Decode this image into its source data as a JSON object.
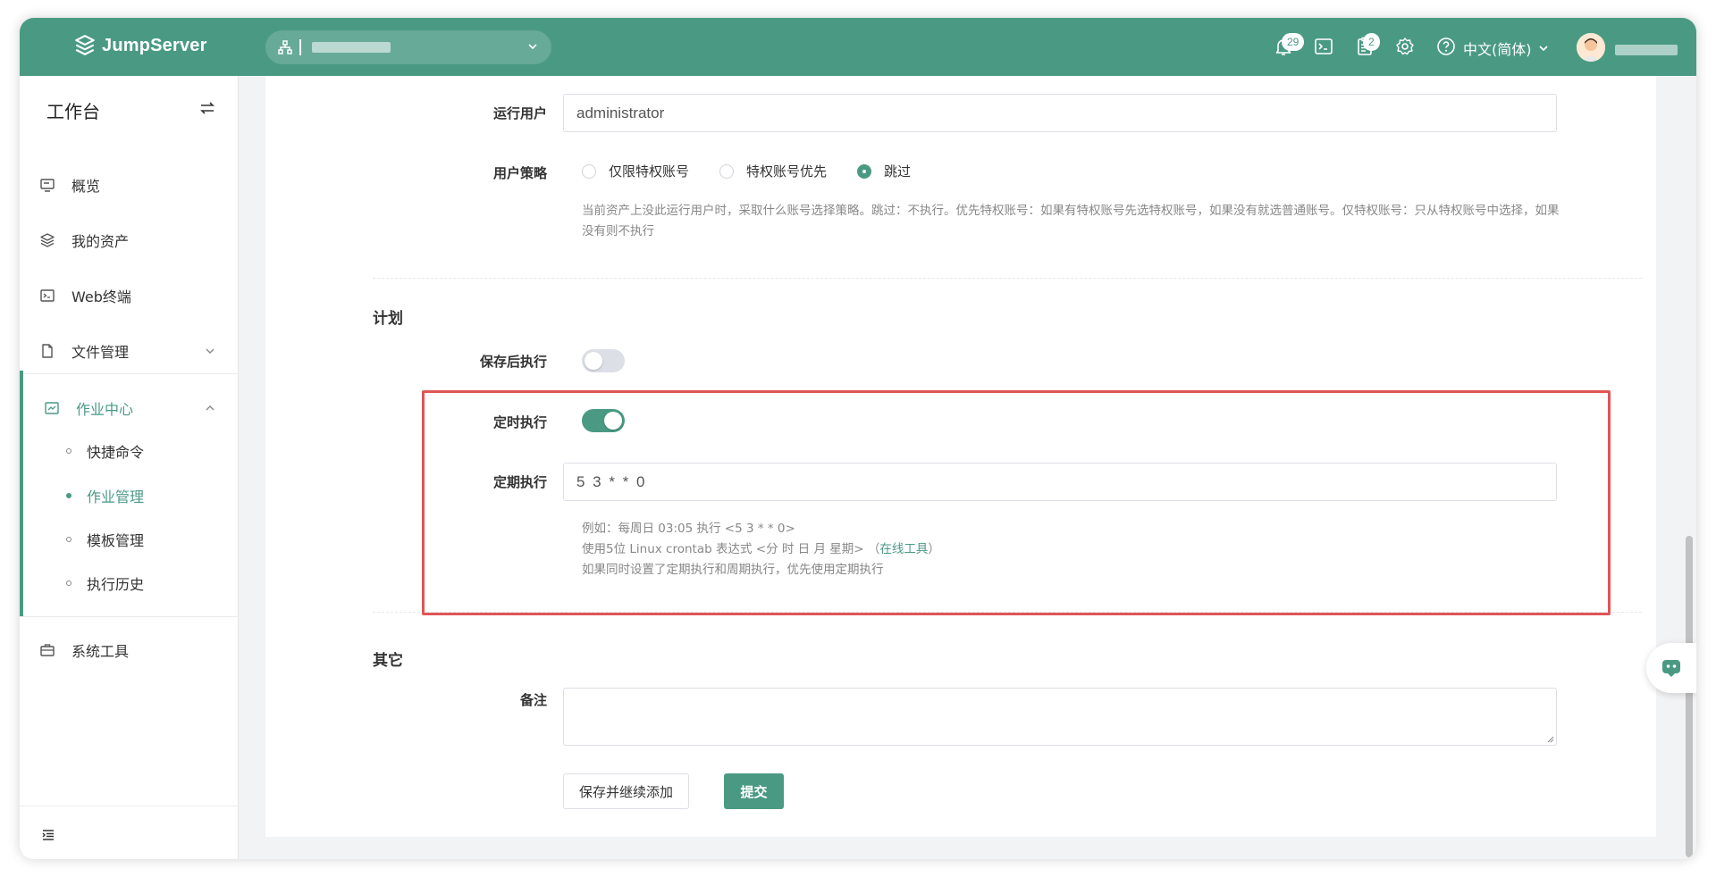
{
  "header": {
    "logo_text": "JumpServer",
    "org_select": {
      "value": "",
      "placeholder": ""
    },
    "notifications_count": "29",
    "tickets_count": "2",
    "language": "中文(简体)",
    "username": "",
    "icons": [
      "bell-icon",
      "terminal-icon",
      "clipboard-icon",
      "gear-icon",
      "help-icon",
      "chevron-down-icon"
    ]
  },
  "sidebar": {
    "title": "工作台",
    "items": [
      {
        "label": "概览",
        "icon": "monitor-icon"
      },
      {
        "label": "我的资产",
        "icon": "layers-icon"
      },
      {
        "label": "Web终端",
        "icon": "terminal-icon"
      },
      {
        "label": "文件管理",
        "icon": "file-icon"
      },
      {
        "label": "作业中心",
        "icon": "job-icon"
      },
      {
        "label": "系统工具",
        "icon": "toolbox-icon"
      }
    ],
    "sub_items": [
      {
        "label": "快捷命令"
      },
      {
        "label": "作业管理"
      },
      {
        "label": "模板管理"
      },
      {
        "label": "执行历史"
      }
    ],
    "active_color": "#4a9a83"
  },
  "form": {
    "run_user": {
      "label": "运行用户",
      "value": "administrator"
    },
    "user_strategy": {
      "label": "用户策略",
      "options": [
        "仅限特权账号",
        "特权账号优先",
        "跳过"
      ],
      "selected": "跳过",
      "help": "当前资产上没此运行用户时，采取什么账号选择策略。跳过：不执行。优先特权账号：如果有特权账号先选特权账号，如果没有就选普通账号。仅特权账号：只从特权账号中选择，如果没有则不执行"
    },
    "plan_section": "计划",
    "run_after_save": {
      "label": "保存后执行",
      "on": false
    },
    "timed_run": {
      "label": "定时执行",
      "on": true
    },
    "crontab": {
      "label": "定期执行",
      "value": "5 3 * * 0",
      "help_line1": "例如：每周日 03:05 执行 <5 3 * * 0>",
      "help_line2_prefix": "使用5位 Linux crontab 表达式 <分 时 日 月 星期> （",
      "help_link": "在线工具",
      "help_line2_suffix": "）",
      "help_line3": "如果同时设置了定期执行和周期执行，优先使用定期执行"
    },
    "other_section": "其它",
    "comment": {
      "label": "备注",
      "value": ""
    },
    "buttons": {
      "save_continue": "保存并继续添加",
      "submit": "提交"
    }
  },
  "colors": {
    "brand": "#4a9a83",
    "highlight": "#e05555"
  }
}
